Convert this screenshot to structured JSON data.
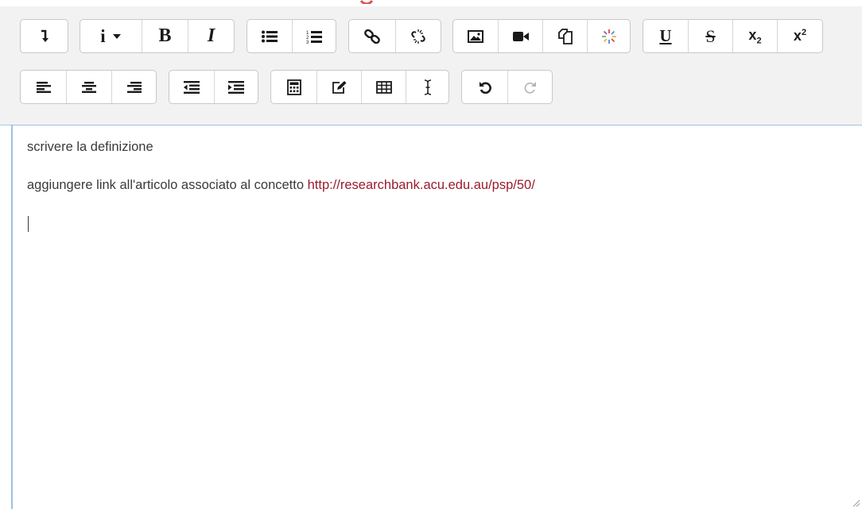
{
  "editor": {
    "paragraphs": [
      {
        "text": "scrivere la definizione"
      },
      {
        "text": "aggiungere link all'articolo associato al concetto ",
        "link": "http://researchbank.acu.edu.au/psp/50/"
      }
    ]
  },
  "toolbar": {
    "row1": [
      {
        "name": "toolbar-toggle-button",
        "icon": "arrow-down-icon"
      },
      {
        "name": "paragraph-styles-button",
        "icon": "info-dropdown-icon",
        "label": "i"
      },
      {
        "name": "bold-button",
        "icon": "bold-icon",
        "label": "B"
      },
      {
        "name": "italic-button",
        "icon": "italic-icon",
        "label": "I"
      },
      {
        "name": "unordered-list-button",
        "icon": "bullet-list-icon"
      },
      {
        "name": "ordered-list-button",
        "icon": "numbered-list-icon"
      },
      {
        "name": "link-button",
        "icon": "link-icon"
      },
      {
        "name": "unlink-button",
        "icon": "unlink-icon"
      },
      {
        "name": "insert-image-button",
        "icon": "image-icon"
      },
      {
        "name": "insert-media-button",
        "icon": "video-icon"
      },
      {
        "name": "manage-files-button",
        "icon": "files-icon"
      },
      {
        "name": "insert-emoticon-button",
        "icon": "sparkle-icon"
      },
      {
        "name": "underline-button",
        "icon": "underline-icon",
        "label": "U"
      },
      {
        "name": "strikethrough-button",
        "icon": "strikethrough-icon",
        "label": "S"
      },
      {
        "name": "subscript-button",
        "icon": "subscript-icon",
        "label": "x",
        "sub": "2"
      },
      {
        "name": "superscript-button",
        "icon": "superscript-icon",
        "label": "x",
        "sup": "2"
      }
    ],
    "row2": [
      {
        "name": "align-left-button",
        "icon": "align-left-icon"
      },
      {
        "name": "align-center-button",
        "icon": "align-center-icon"
      },
      {
        "name": "align-right-button",
        "icon": "align-right-icon"
      },
      {
        "name": "outdent-button",
        "icon": "outdent-icon"
      },
      {
        "name": "indent-button",
        "icon": "indent-icon"
      },
      {
        "name": "equation-button",
        "icon": "calculator-icon"
      },
      {
        "name": "special-character-button",
        "icon": "pencil-square-icon"
      },
      {
        "name": "table-button",
        "icon": "table-icon"
      },
      {
        "name": "clear-formatting-button",
        "icon": "text-cursor-icon"
      },
      {
        "name": "undo-button",
        "icon": "undo-icon",
        "enabled": true
      },
      {
        "name": "redo-button",
        "icon": "redo-icon",
        "enabled": false
      }
    ]
  },
  "colors": {
    "link": "#9b1b2e",
    "toolbar_background": "#f2f2f2",
    "focus_border": "#9ec2e3",
    "disabled_icon": "#b3b3b3",
    "emoticon_accent": "#e0443f"
  }
}
